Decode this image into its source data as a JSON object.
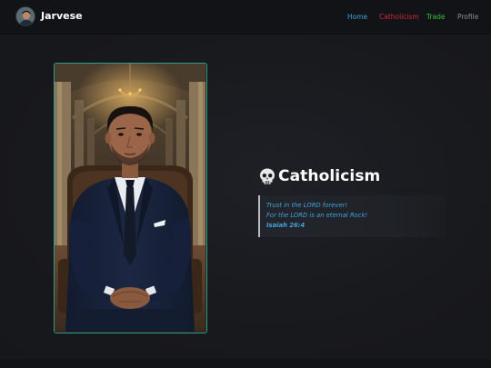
{
  "header": {
    "brand": "Jarvese",
    "nav": [
      {
        "label": "Home",
        "color": "#3aa3de"
      },
      {
        "label": "Catholicism",
        "color": "#d6243a"
      },
      {
        "label": "Trade",
        "color": "#35c13c"
      },
      {
        "label": "Profile",
        "color": "#8e9095"
      }
    ]
  },
  "main": {
    "heading": "Catholicism",
    "heading_icon": "skull-icon",
    "quote": {
      "line1": "Trust in the LORD forever!",
      "line2": "For the LORD is an eternal Rock!",
      "reference": "Isaiah 26:4"
    },
    "photo": "portrait of a man in a navy suit seated in an ornate hall"
  },
  "colors": {
    "background": "#18191d",
    "navbar": "#121316",
    "frame_border": "#2c9c8b",
    "quote_text": "#41a3dd"
  }
}
